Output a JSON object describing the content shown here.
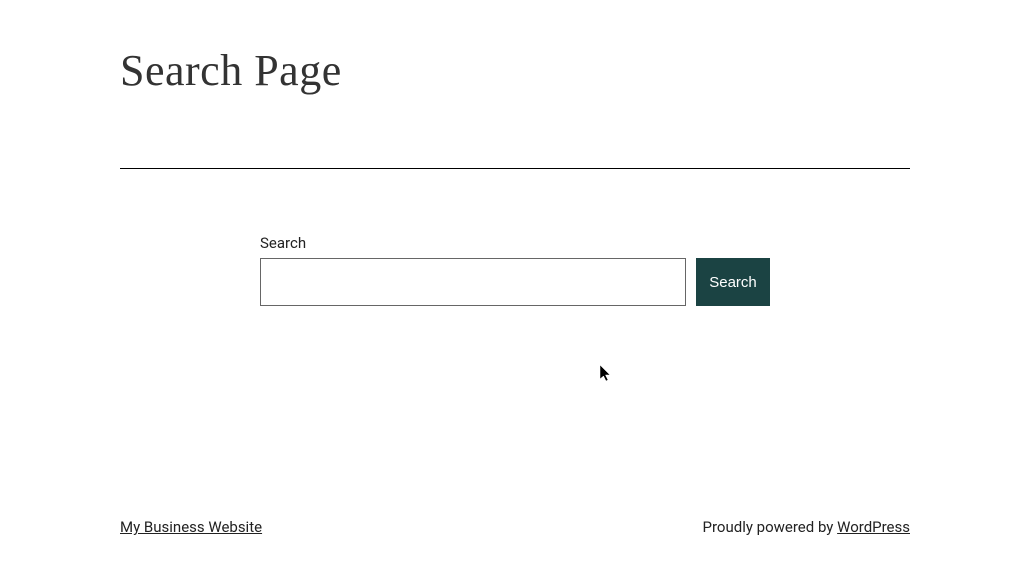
{
  "page": {
    "title": "Search Page"
  },
  "search": {
    "label": "Search",
    "button_label": "Search",
    "value": ""
  },
  "footer": {
    "site_link": "My Business Website",
    "powered_prefix": "Proudly powered by ",
    "powered_link": "WordPress"
  }
}
